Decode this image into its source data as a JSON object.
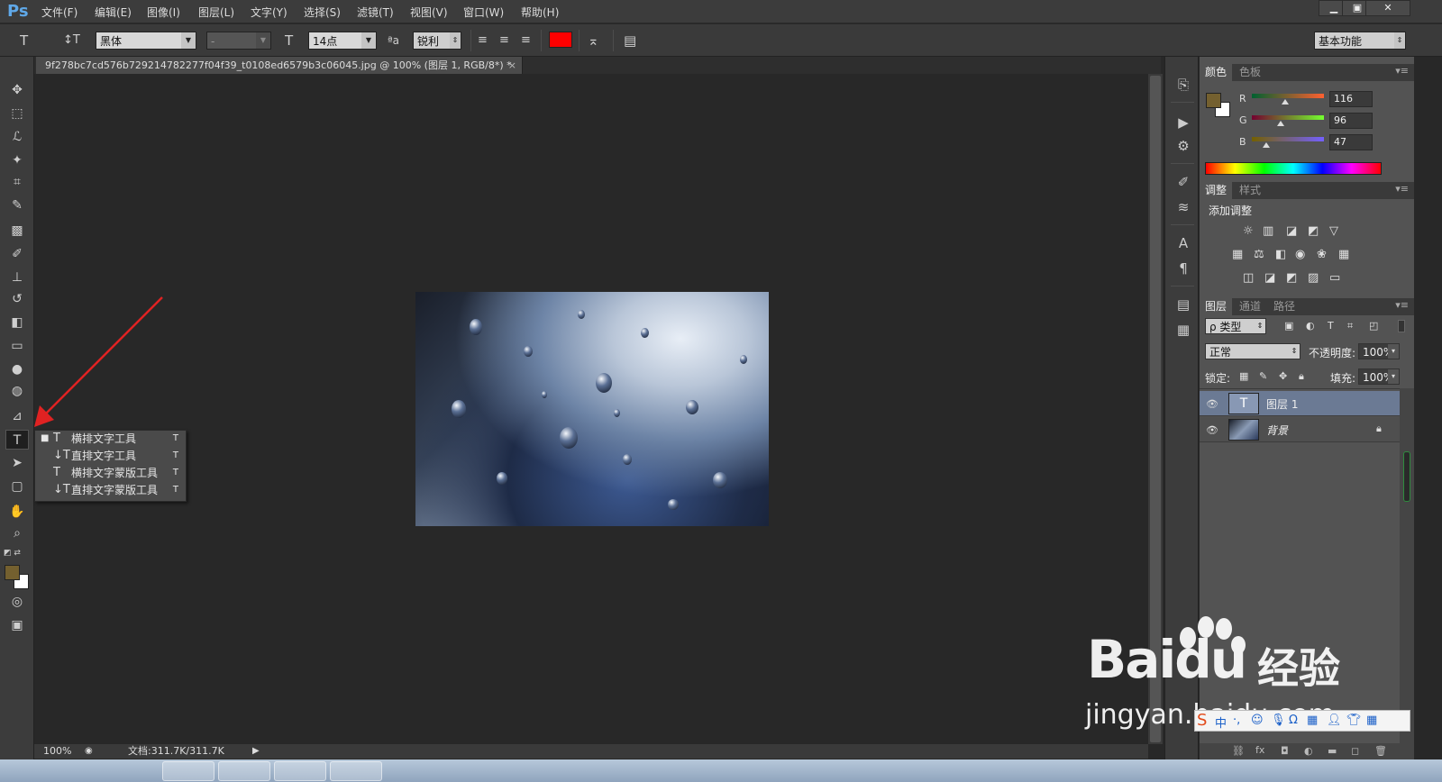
{
  "app": {
    "logo": "Ps",
    "menus": [
      "文件(F)",
      "编辑(E)",
      "图像(I)",
      "图层(L)",
      "文字(Y)",
      "选择(S)",
      "滤镜(T)",
      "视图(V)",
      "窗口(W)",
      "帮助(H)"
    ],
    "window_buttons": [
      "▁",
      "▣",
      "✕"
    ]
  },
  "options": {
    "tool_icon": "T",
    "orient_icon": "↕T",
    "font_family": "黑体",
    "font_style": "-",
    "size_icon": "T",
    "font_size": "14点",
    "aa_icon": "ªa",
    "antialias": "锐利",
    "text_color": "#ff0000",
    "workspace": "基本功能"
  },
  "document": {
    "tab_title": "9f278bc7cd576b729214782277f04f39_t0108ed6579b3c06045.jpg @ 100% (图层 1, RGB/8*) *",
    "close": "×"
  },
  "status": {
    "zoom": "100%",
    "doc_info": "文档:311.7K/311.7K"
  },
  "flyout": [
    {
      "icon": "T",
      "label": "横排文字工具",
      "shortcut": "T",
      "selected": true
    },
    {
      "icon": "↓T",
      "label": "直排文字工具",
      "shortcut": "T",
      "selected": false
    },
    {
      "icon": "T",
      "label": "横排文字蒙版工具",
      "shortcut": "T",
      "selected": false
    },
    {
      "icon": "↓T",
      "label": "直排文字蒙版工具",
      "shortcut": "T",
      "selected": false
    }
  ],
  "color_panel": {
    "tabs": [
      "颜色",
      "色板"
    ],
    "r_label": "R",
    "g_label": "G",
    "b_label": "B",
    "r": "116",
    "g": "96",
    "b": "47",
    "foreground": "#74602f",
    "background": "#ffffff"
  },
  "adjust_panel": {
    "tabs": [
      "调整",
      "样式"
    ],
    "title": "添加调整"
  },
  "layers_panel": {
    "tabs": [
      "图层",
      "通道",
      "路径"
    ],
    "filter_kind": "ρ 类型",
    "blend_mode": "正常",
    "opacity_label": "不透明度:",
    "opacity": "100%",
    "lock_label": "锁定:",
    "fill_label": "填充:",
    "fill": "100%",
    "layers": [
      {
        "name": "图层 1",
        "type": "text",
        "selected": true
      },
      {
        "name": "背景",
        "type": "image",
        "selected": false,
        "locked": true
      }
    ]
  },
  "watermark": {
    "brand": "Bai",
    "paw_suffix": "du",
    "cn": "经验",
    "url": "jingyan.baidu.com"
  }
}
